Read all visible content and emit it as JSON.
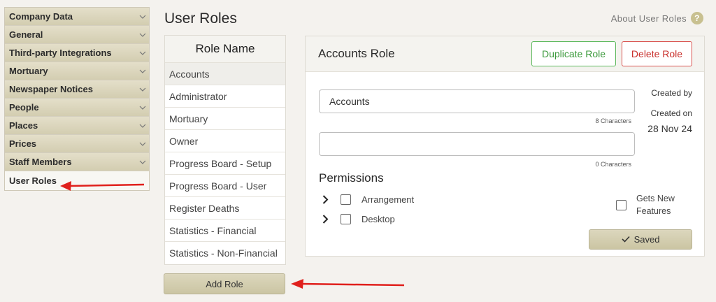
{
  "sidebar": {
    "items": [
      {
        "label": "Company Data"
      },
      {
        "label": "General"
      },
      {
        "label": "Third-party Integrations"
      },
      {
        "label": "Mortuary"
      },
      {
        "label": "Newspaper Notices"
      },
      {
        "label": "People"
      },
      {
        "label": "Places"
      },
      {
        "label": "Prices"
      },
      {
        "label": "Staff Members"
      }
    ],
    "active_label": "User Roles"
  },
  "page": {
    "title": "User Roles",
    "about_link": "About User Roles",
    "help_glyph": "?"
  },
  "roles": {
    "header": "Role Name",
    "items": [
      "Accounts",
      "Administrator",
      "Mortuary",
      "Owner",
      "Progress Board - Setup",
      "Progress Board - User",
      "Register Deaths",
      "Statistics - Financial",
      "Statistics - Non-Financial"
    ],
    "selected": "Accounts",
    "add_button": "Add Role"
  },
  "detail": {
    "title": "Accounts Role",
    "duplicate_button": "Duplicate Role",
    "delete_button": "Delete Role",
    "name_value": "Accounts",
    "name_count": "8 Characters",
    "desc_value": "",
    "desc_count": "0 Characters",
    "created_by_label": "Created by",
    "created_on_label": "Created on",
    "created_on_value": "28 Nov 24",
    "permissions_title": "Permissions",
    "permissions": [
      {
        "label": "Arrangement",
        "checked": false
      },
      {
        "label": "Desktop",
        "checked": false
      }
    ],
    "gets_new_features": "Gets New Features",
    "saved_button": "Saved"
  },
  "icons": {
    "chevron": "chevron-down-icon",
    "caret": "chevron-right-icon",
    "check": "check-icon",
    "arrow": "red-arrow-icon"
  },
  "colors": {
    "sidebar_bg": "#d8d2b8",
    "duplicate": "#5cb85c",
    "delete": "#d9534f",
    "arrow": "#e0201c"
  }
}
